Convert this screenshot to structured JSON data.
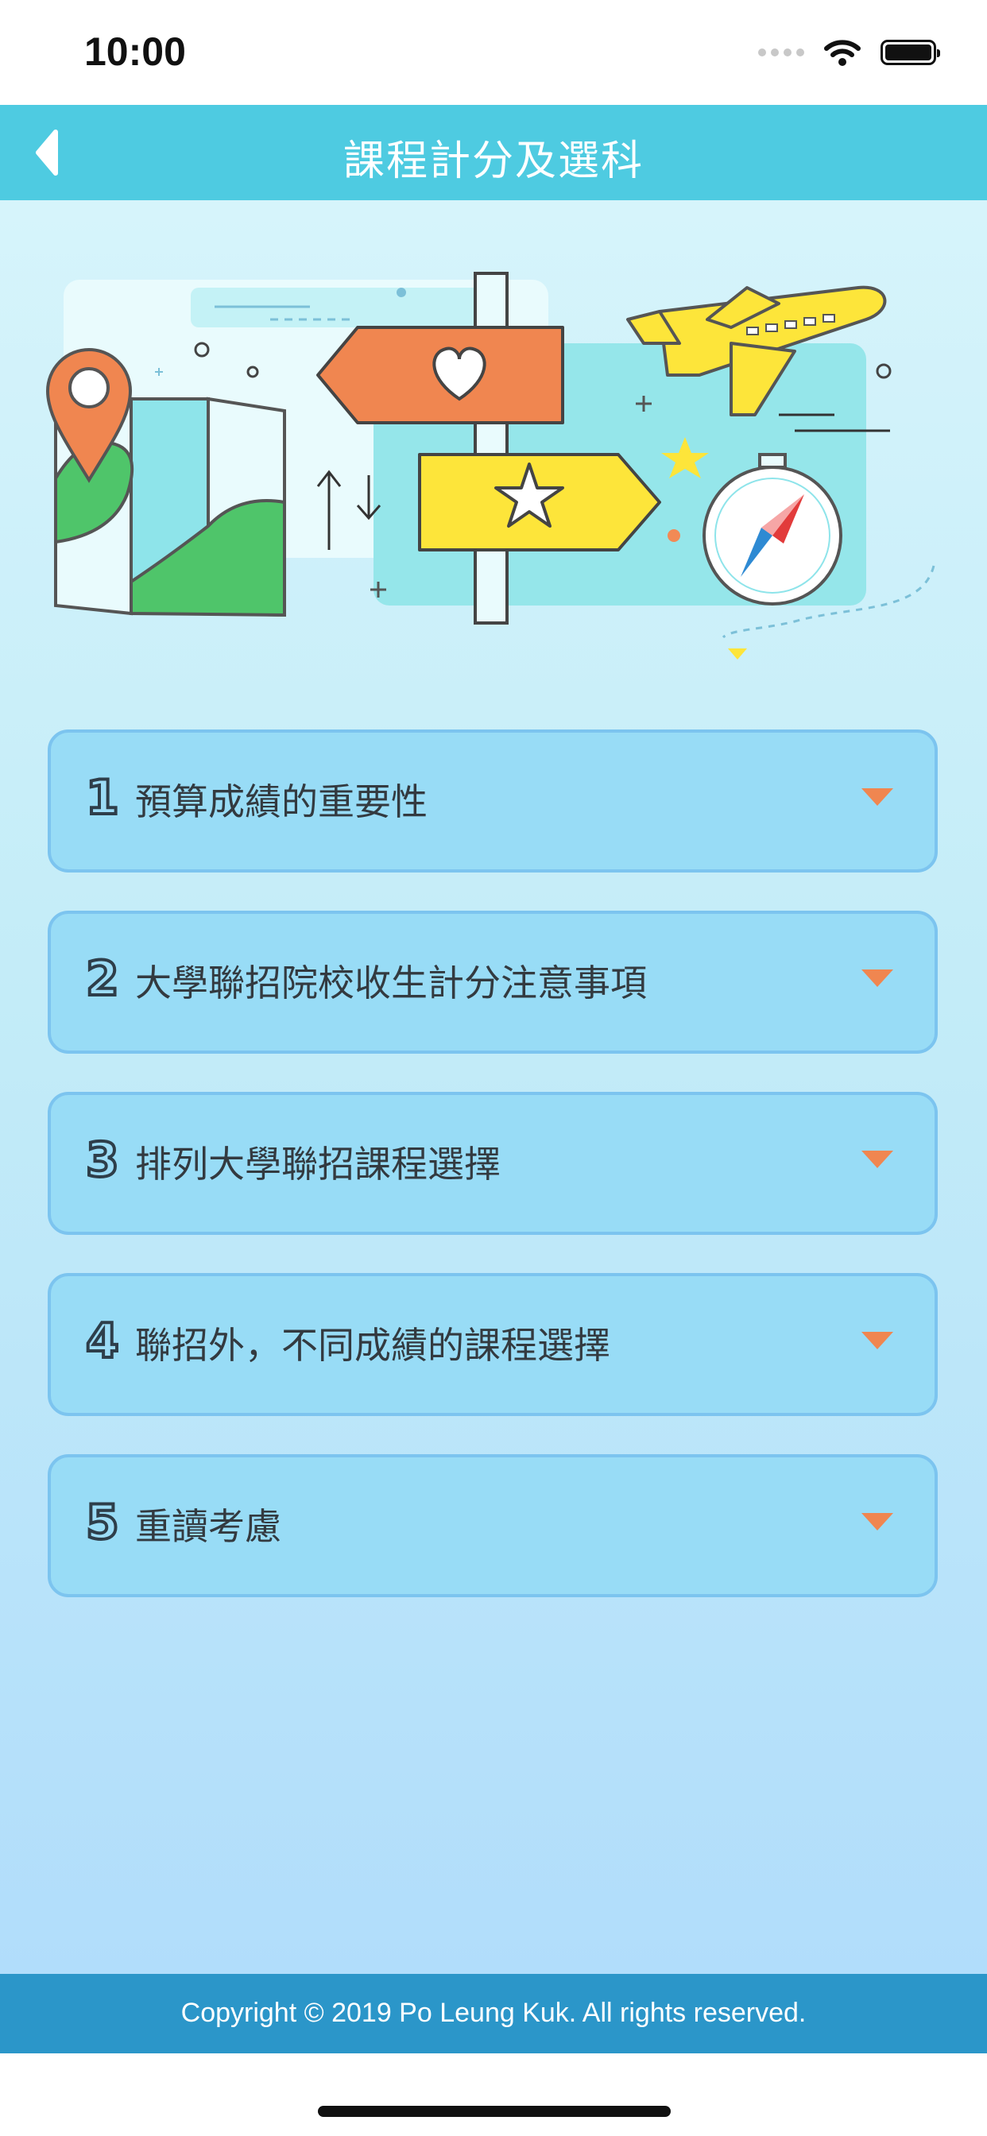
{
  "status_bar": {
    "time": "10:00"
  },
  "header": {
    "title": "課程計分及選科",
    "back_icon": "chevron-left-icon"
  },
  "hero": {
    "description": ""
  },
  "sections": [
    {
      "number": "1",
      "label": "預算成績的重要性"
    },
    {
      "number": "2",
      "label": "大學聯招院校收生計分注意事項"
    },
    {
      "number": "3",
      "label": "排列大學聯招課程選擇"
    },
    {
      "number": "4",
      "label": "聯招外，不同成績的課程選擇"
    },
    {
      "number": "5",
      "label": "重讀考慮"
    }
  ],
  "footer": {
    "copyright": "Copyright © 2019 Po Leung Kuk. All rights reserved."
  },
  "colors": {
    "header_bg": "#4ecbe1",
    "accordion_bg": "#98dcf6",
    "accordion_border": "#7cc4ef",
    "caret": "#f08650",
    "footer_bg": "#2b96c9"
  }
}
